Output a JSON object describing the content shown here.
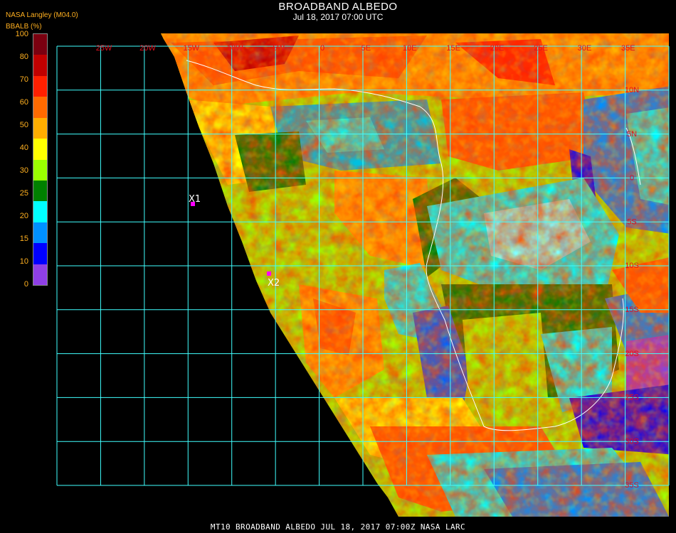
{
  "header": {
    "title": "BROADBAND ALBEDO",
    "datetime": "Jul 18, 2017 07:00 UTC",
    "source": "NASA Langley (M04.0)"
  },
  "legend": {
    "unit_label": "BBALB (%)",
    "ticks": [
      "100",
      "80",
      "70",
      "60",
      "50",
      "40",
      "30",
      "25",
      "20",
      "15",
      "10",
      "0"
    ],
    "colors": [
      "#7a0010",
      "#c00000",
      "#ff2000",
      "#ff6a00",
      "#ffae00",
      "#ffff00",
      "#9bff00",
      "#008000",
      "#00ffff",
      "#0090ff",
      "#0000ff",
      "#8f3fe6"
    ]
  },
  "map": {
    "grid_color": "#40ffff",
    "longitude_labels": [
      "25W",
      "20W",
      "15W",
      "10W",
      "5W",
      "0",
      "5E",
      "10E",
      "15E",
      "20E",
      "25E",
      "30E",
      "35E"
    ],
    "latitude_labels": [
      "10N",
      "5N",
      "0",
      "5S",
      "10S",
      "15S",
      "20S",
      "25S",
      "30S",
      "35S"
    ],
    "markers": [
      {
        "label": "X1",
        "color": "#ff00ff"
      },
      {
        "label": "X2",
        "color": "#ff00ff"
      }
    ]
  },
  "footer": {
    "caption": "MT10  BROADBAND ALBEDO   JUL 18, 2017 07:00Z   NASA LARC"
  }
}
